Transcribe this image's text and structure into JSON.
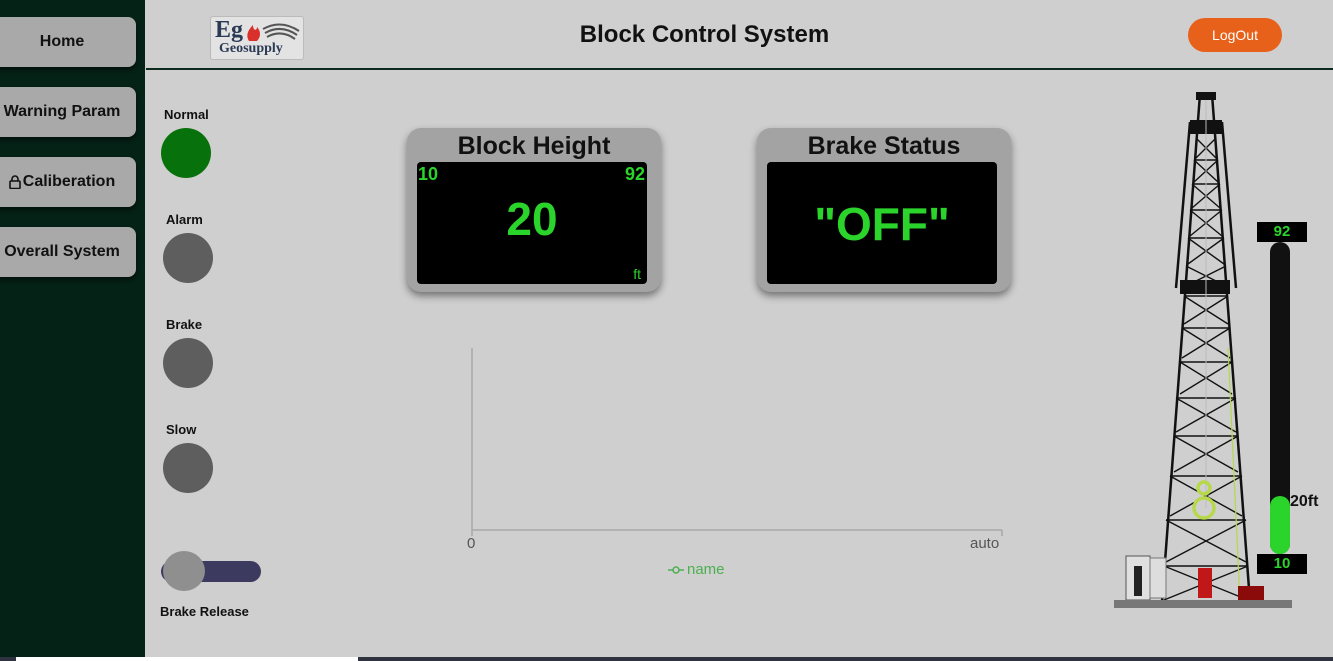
{
  "sidebar": {
    "items": [
      {
        "label": "Home"
      },
      {
        "label": "Warning Param"
      },
      {
        "label": "Caliberation",
        "icon": "lock-icon"
      },
      {
        "label": "Overall System"
      }
    ]
  },
  "header": {
    "logo_line1": "Eg",
    "logo_line2": "Geosupply",
    "title": "Block Control System",
    "logout_label": "LogOut"
  },
  "indicators": [
    {
      "label": "Normal",
      "state": "on"
    },
    {
      "label": "Alarm",
      "state": "off"
    },
    {
      "label": "Brake",
      "state": "off"
    },
    {
      "label": "Slow",
      "state": "off"
    }
  ],
  "brake_release": {
    "label": "Brake Release",
    "enabled": false
  },
  "block_height": {
    "title": "Block Height",
    "min": "10",
    "max": "92",
    "value": "20",
    "unit": "ft"
  },
  "brake_status": {
    "title": "Brake Status",
    "value": "\"OFF\""
  },
  "chart": {
    "x_min_label": "0",
    "x_max_label": "auto",
    "legend": "name"
  },
  "rig_gauge": {
    "max": "92",
    "min": "10",
    "value": 20,
    "reading": "20ft"
  },
  "colors": {
    "accent_green": "#2bd42b",
    "sidebar_bg": "#052217",
    "logout": "#e8611a",
    "lamp_on": "#07720b",
    "lamp_off": "#5e5e5e"
  }
}
